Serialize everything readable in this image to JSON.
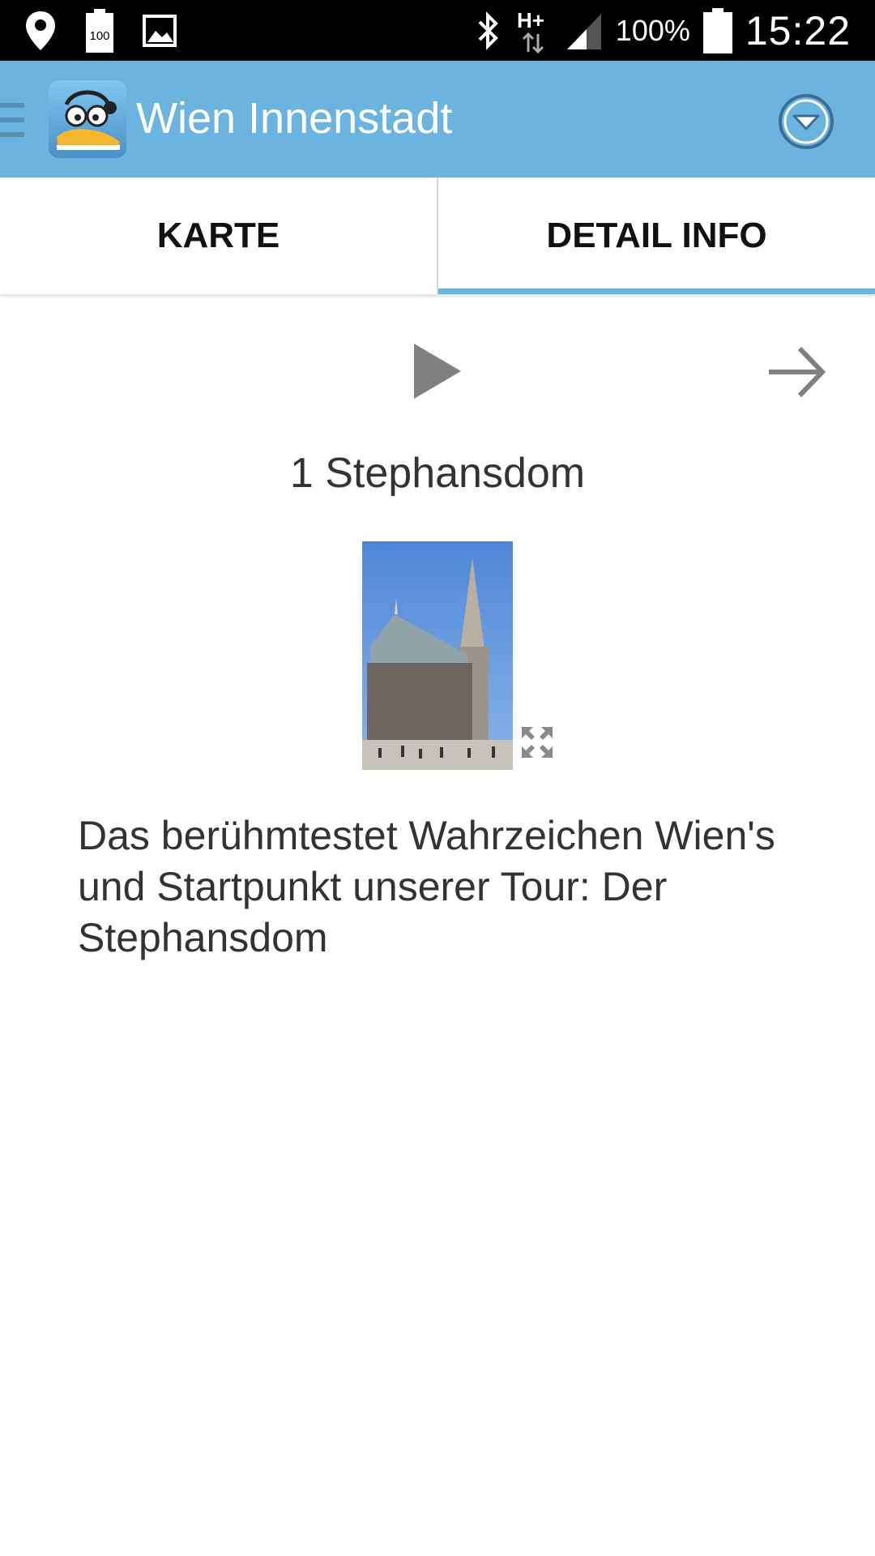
{
  "status_bar": {
    "battery_percent": "100%",
    "time": "15:22",
    "icons": [
      "location-icon",
      "battery-saver-icon",
      "gallery-icon",
      "bluetooth-icon",
      "network-hplus-icon",
      "signal-icon",
      "battery-icon"
    ],
    "battery_saver_label": "100",
    "network_label": "H+"
  },
  "action_bar": {
    "title": "Wien Innenstadt",
    "color": "#6cb4e0"
  },
  "tabs": [
    {
      "label": "KARTE",
      "selected": false
    },
    {
      "label": "DETAIL INFO",
      "selected": true
    }
  ],
  "detail": {
    "title": "1 Stephansdom",
    "description": "Das berühmtestet Wahrzeichen Wien's und Startpunkt unserer Tour: Der Stephansdom"
  }
}
